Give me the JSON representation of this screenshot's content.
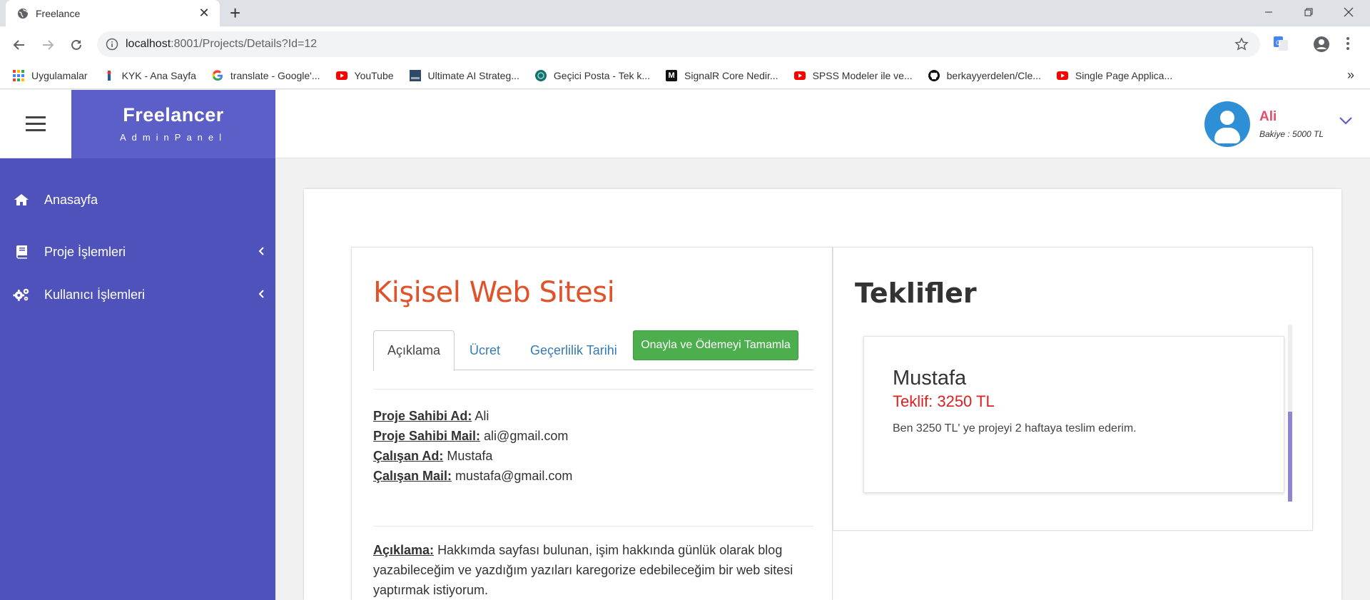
{
  "browser": {
    "tab_title": "Freelance",
    "url_host": "localhost",
    "url_rest": ":8001/Projects/Details?Id=12",
    "bookmarks": [
      {
        "label": "Uygulamalar",
        "icon": "apps-grid-icon"
      },
      {
        "label": "KYK - Ana Sayfa",
        "icon": "kyk-icon"
      },
      {
        "label": "translate - Google'...",
        "icon": "google-icon"
      },
      {
        "label": "YouTube",
        "icon": "youtube-icon"
      },
      {
        "label": "Ultimate AI Strateg...",
        "icon": "page-icon"
      },
      {
        "label": "Geçici Posta - Tek k...",
        "icon": "tempmail-icon"
      },
      {
        "label": "SignalR Core Nedir...",
        "icon": "medium-icon"
      },
      {
        "label": "SPSS Modeler ile ve...",
        "icon": "youtube-icon"
      },
      {
        "label": "berkayyerdelen/Cle...",
        "icon": "github-icon"
      },
      {
        "label": "Single Page Applica...",
        "icon": "youtube-icon"
      }
    ],
    "more": "»"
  },
  "app": {
    "brand_name": "Freelancer",
    "brand_sub": "AdminPanel",
    "user": {
      "name": "Ali",
      "balance": "Bakiye : 5000 TL"
    },
    "sidebar": [
      {
        "label": "Anasayfa",
        "icon": "home-icon",
        "has_chevron": false
      },
      {
        "label": "Proje İşlemleri",
        "icon": "book-icon",
        "has_chevron": true
      },
      {
        "label": "Kullanıcı İşlemleri",
        "icon": "gears-icon",
        "has_chevron": true
      }
    ],
    "chevron": "<"
  },
  "project": {
    "title": "Kişisel Web Sitesi",
    "tabs": [
      "Açıklama",
      "Ücret",
      "Geçerlilik Tarihi"
    ],
    "approve_button": "Onayla ve Ödemeyi Tamamla",
    "owner_name_label": "Proje Sahibi Ad:",
    "owner_name": "Ali",
    "owner_mail_label": "Proje Sahibi Mail:",
    "owner_mail": "ali@gmail.com",
    "worker_name_label": "Çalışan Ad:",
    "worker_name": "Mustafa",
    "worker_mail_label": "Çalışan Mail:",
    "worker_mail": "mustafa@gmail.com",
    "desc_label": "Açıklama:",
    "desc_line1": "Hakkımda sayfası bulunan, işim hakkında günlük olarak blog",
    "desc_line2": "yazabileceğim ve yazdığım yazıları karegorize edebileceğim bir web sitesi",
    "desc_line3": "yaptırmak istiyorum."
  },
  "offers": {
    "title": "Teklifler",
    "items": [
      {
        "name": "Mustafa",
        "price": "Teklif: 3250 TL",
        "text": "Ben 3250 TL' ye projeyi 2 haftaya teslim ederim."
      }
    ]
  },
  "colors": {
    "brand": "#5c5fc8",
    "sidebar": "#5052bb",
    "title_accent": "#e0522a",
    "approve": "#4cae4c",
    "price": "#e01e1e",
    "user_name": "#e04e6a"
  }
}
